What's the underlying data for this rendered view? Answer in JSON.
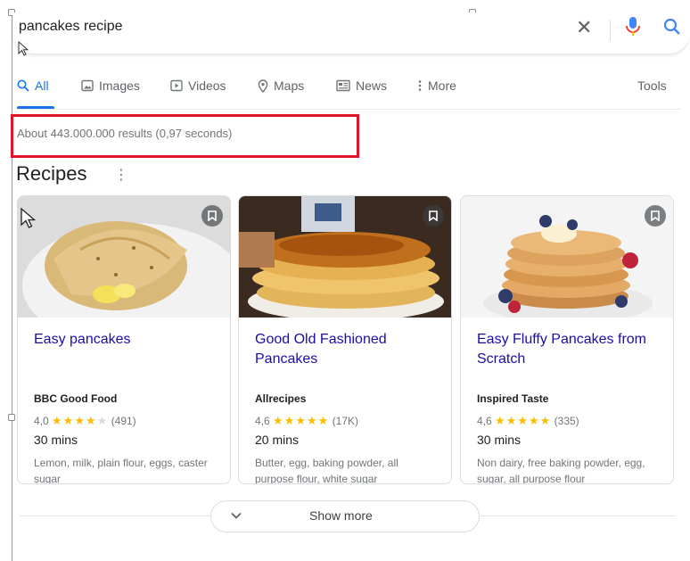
{
  "search": {
    "query": "pancakes recipe"
  },
  "tabs": [
    {
      "label": "All",
      "icon": "search-icon",
      "active": true
    },
    {
      "label": "Images",
      "icon": "image-icon"
    },
    {
      "label": "Videos",
      "icon": "video-icon"
    },
    {
      "label": "Maps",
      "icon": "map-pin-icon"
    },
    {
      "label": "News",
      "icon": "news-icon"
    },
    {
      "label": "More",
      "icon": "more-vert-icon"
    }
  ],
  "tools_label": "Tools",
  "result_stats": "About 443.000.000 results (0,97 seconds)",
  "recipes": {
    "heading": "Recipes",
    "cards": [
      {
        "title": "Easy pancakes",
        "source": "BBC Good Food",
        "rating": "4,0",
        "stars": 4,
        "reviews": "(491)",
        "time": "30 mins",
        "ingredients": "Lemon, milk, plain flour, eggs, caster sugar"
      },
      {
        "title": "Good Old Fashioned Pancakes",
        "source": "Allrecipes",
        "rating": "4,6",
        "stars": 4.5,
        "reviews": "(17K)",
        "time": "20 mins",
        "ingredients": "Butter, egg, baking powder, all purpose flour, white sugar"
      },
      {
        "title": "Easy Fluffy Pancakes from Scratch",
        "source": "Inspired Taste",
        "rating": "4,6",
        "stars": 4.5,
        "reviews": "(335)",
        "time": "30 mins",
        "ingredients": "Non dairy, free baking powder, egg, sugar, all purpose flour"
      }
    ]
  },
  "show_more_label": "Show more",
  "colors": {
    "accent": "#1a73e8",
    "link": "#1a0dab",
    "highlight": "#e0152b",
    "star": "#fbbc04"
  }
}
